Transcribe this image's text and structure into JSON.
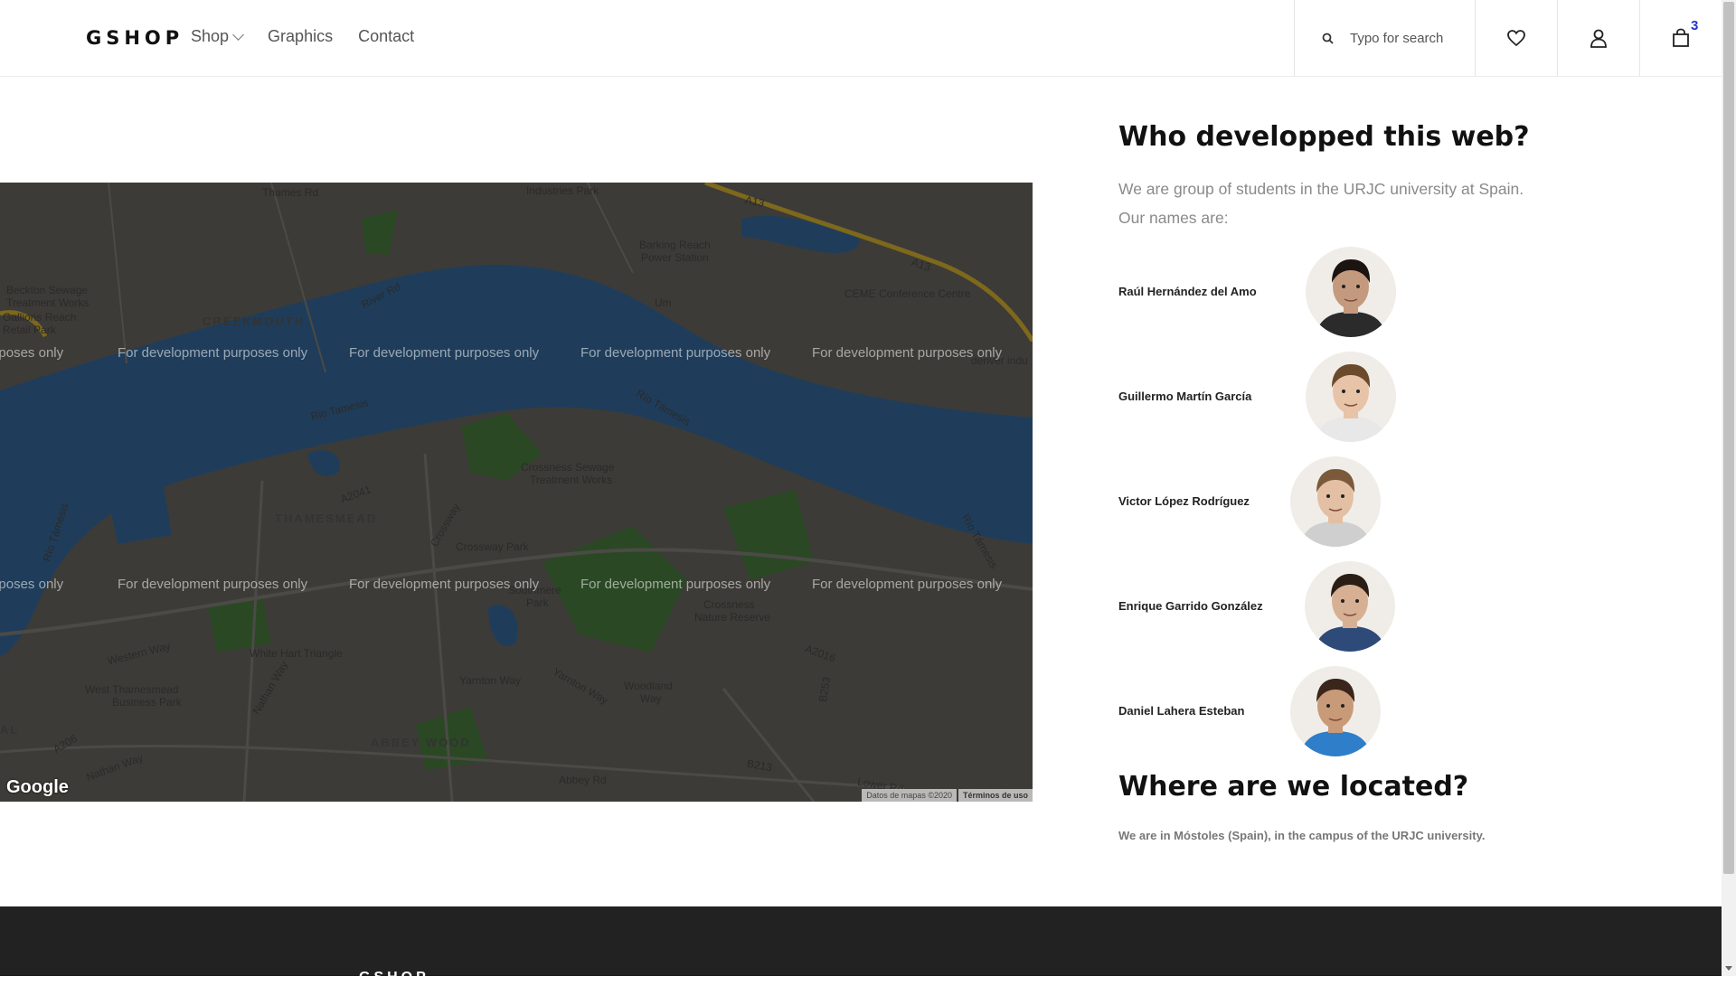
{
  "header": {
    "logo": "GSHOP",
    "nav": [
      {
        "label": "Shop"
      },
      {
        "label": "Graphics"
      },
      {
        "label": "Contact"
      }
    ],
    "search_placeholder": "Typo for search",
    "cart_count": "3"
  },
  "map": {
    "watermark": "For development purposes only",
    "google": "Google",
    "attribution": "Datos de mapas ©2020",
    "terms": "Términos de uso",
    "labels": {
      "thames_rd": "Thames Rd",
      "industries_park": "Industries Park",
      "a13": "A13",
      "a13b": "A13",
      "barking_reach": "Barking Reach",
      "power_station": "Power Station",
      "beckton": "Beckton Sewage",
      "treatment": "Treatment Works",
      "gallions": "Gallions Reach",
      "retail": "Retail Park",
      "river_rd": "River Rd",
      "creekmouth": "CREEKMOUTH",
      "um": "Um",
      "ceme": "CEME Conference Centre",
      "denver": "denver indu",
      "rio1": "Rio Tamesis",
      "rio2": "Río Támesis",
      "rio3": "Río Támesis",
      "rio4": "Río Támesis",
      "crossness_sewage": "Crossness Sewage",
      "crossness_treat": "Treatment Works",
      "a2041": "A2041",
      "thamesmead": "THAMESMEAD",
      "crossway": "Crossway",
      "crossway_park": "Crossway Park",
      "southmere": "Southmere",
      "southmere_park": "Park",
      "crossness_nr": "Crossness",
      "nature_reserve": "Nature Reserve",
      "a2016": "A2016",
      "white_hart": "White Hart Triangle",
      "west_thamesmead": "West Thamesmead",
      "business_park": "Business Park",
      "western_way": "Western Way",
      "nathan_way": "Nathan Way",
      "yarnton": "Yarnton Way",
      "yarnton2": "Yarnton Way",
      "woodland": "Woodland",
      "woodland_way": "Way",
      "abbey_wood": "ABBEY WOOD",
      "a206": "A206",
      "nathan_way2": "Nathan Way",
      "abbey_rd": "Abbey Rd",
      "b213": "B213",
      "lower_rd": "Lower Rd",
      "al": "AL",
      "b253": "B253"
    }
  },
  "about": {
    "title": "Who developped this web?",
    "intro_line1": "We are group of students in the URJC university at Spain.",
    "intro_line2": "Our names are:",
    "developers": [
      {
        "name": "Raúl Hernández del Amo",
        "shirt": "#2b2b2b",
        "hair": "#1b1411",
        "skin": "#c49a7e"
      },
      {
        "name": "Guillermo Martín García",
        "shirt": "#e8e8e8",
        "hair": "#6a4a2a",
        "skin": "#e7c3a8"
      },
      {
        "name": "Victor López Rodríguez",
        "shirt": "#cfcfcf",
        "hair": "#7a5a3a",
        "skin": "#e3bfa4"
      },
      {
        "name": "Enrique Garrido González",
        "shirt": "#2e4a78",
        "hair": "#2a1d16",
        "skin": "#d7b094"
      },
      {
        "name": "Daniel Lahera Esteban",
        "shirt": "#2f7ec9",
        "hair": "#3a261a",
        "skin": "#c89a78"
      }
    ]
  },
  "location": {
    "title": "Where are we located?",
    "text": "We are in Móstoles (Spain), in the campus of the URJC university."
  },
  "footer": {
    "logo": "GSHOP"
  },
  "icons": {
    "search": "search-icon",
    "wishlist": "heart-icon",
    "account": "user-icon",
    "cart": "shopping-bag-icon"
  }
}
